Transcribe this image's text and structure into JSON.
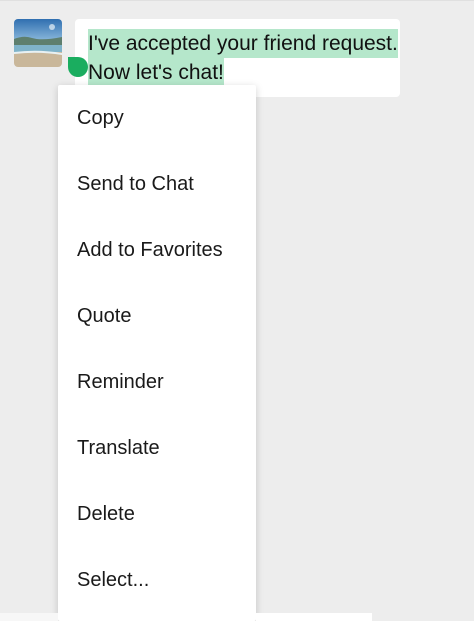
{
  "chat": {
    "message_line1": "I've accepted your friend request.",
    "message_line2": "Now let's chat!"
  },
  "icons": {
    "avatar": "beach-photo-avatar",
    "selection_handle": "text-selection-handle"
  },
  "colors": {
    "background": "#ededed",
    "bubble": "#ffffff",
    "selection_highlight": "#b5e7cb",
    "selection_handle": "#1aad5f",
    "menu": "#ffffff",
    "menu_text": "#1a1a1a"
  },
  "context_menu": {
    "items": [
      {
        "label": "Copy"
      },
      {
        "label": "Send to Chat"
      },
      {
        "label": "Add to Favorites"
      },
      {
        "label": "Quote"
      },
      {
        "label": "Reminder"
      },
      {
        "label": "Translate"
      },
      {
        "label": "Delete"
      },
      {
        "label": "Select..."
      }
    ]
  }
}
